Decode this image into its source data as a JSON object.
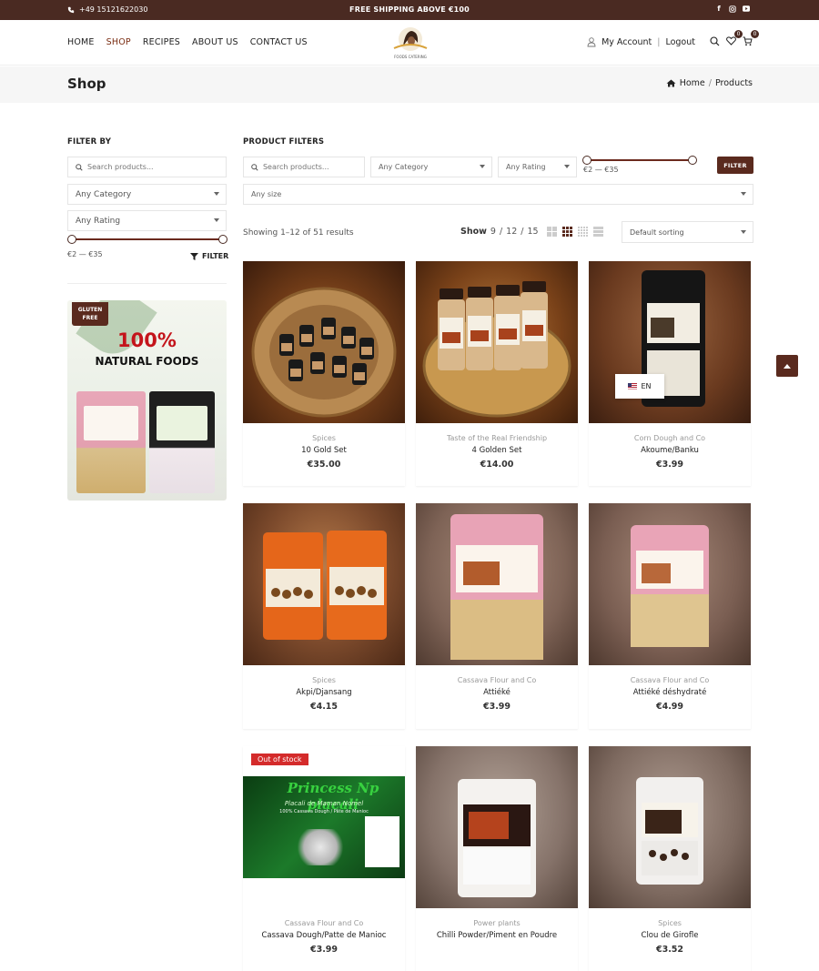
{
  "topbar": {
    "phone": "+49 15121622030",
    "shipping": "FREE SHIPPING ABOVE €100",
    "social": [
      "facebook-icon",
      "instagram-icon",
      "youtube-icon"
    ]
  },
  "header": {
    "nav": [
      "HOME",
      "SHOP",
      "RECIPES",
      "ABOUT US",
      "CONTACT US"
    ],
    "active_nav": "SHOP",
    "logo_text": "FOODS CATERING",
    "account": "My Account",
    "separator": "|",
    "logout": "Logout",
    "wishlist_count": "0",
    "cart_count": "0"
  },
  "page": {
    "title": "Shop",
    "breadcrumb": [
      "Home",
      "Products"
    ],
    "breadcrumb_sep": "/"
  },
  "sidebar": {
    "title": "FILTER BY",
    "search_placeholder": "Search products...",
    "category": "Any Category",
    "rating": "Any Rating",
    "price_range": "€2 — €35",
    "filter_label": "FILTER",
    "promo": {
      "badge_line1": "GLUTEN",
      "badge_line2": "FREE",
      "headline": "100%",
      "subline": "NATURAL FOODS"
    }
  },
  "filters": {
    "title": "PRODUCT FILTERS",
    "search_placeholder": "Search products...",
    "category": "Any Category",
    "rating": "Any Rating",
    "price_range": "€2 — €35",
    "filter_button": "FILTER",
    "size": "Any size"
  },
  "toolbar": {
    "results": "Showing 1–12 of 51 results",
    "show_label": "Show",
    "show_options": [
      "9",
      "12",
      "15"
    ],
    "show_sep": "/",
    "sorting": "Default sorting"
  },
  "language": "EN",
  "colors": {
    "brand": "#4a2a22",
    "accent": "#7a2d12",
    "sale_badge": "#d42b2b"
  },
  "products": [
    {
      "category": "Spices",
      "name": "10 Gold Set",
      "price": "€35.00"
    },
    {
      "category": "Taste of the Real Friendship",
      "name": "4 Golden Set",
      "price": "€14.00"
    },
    {
      "category": "Corn Dough and Co",
      "name": "Akoume/Banku",
      "price": "€3.99"
    },
    {
      "category": "Spices",
      "name": "Akpi/Djansang",
      "price": "€4.15"
    },
    {
      "category": "Cassava Flour and Co",
      "name": "Attiéké",
      "price": "€3.99"
    },
    {
      "category": "Cassava Flour and Co",
      "name": "Attiéké déshydraté",
      "price": "€4.99"
    },
    {
      "category": "Cassava Flour and Co",
      "name": "Cassava Dough/Patte de Manioc",
      "price": "€3.99",
      "badge": "Out of stock",
      "image_title": "Princess Np placali",
      "image_sub": "Placali de Maman Nomel",
      "image_sub2": "100% Cassava Dough / Pâte de Manioc"
    },
    {
      "category": "Power plants",
      "name": "Chilli Powder/Piment en Poudre",
      "price": ""
    },
    {
      "category": "Spices",
      "name": "Clou de Girofle",
      "price": "€3.52"
    }
  ]
}
